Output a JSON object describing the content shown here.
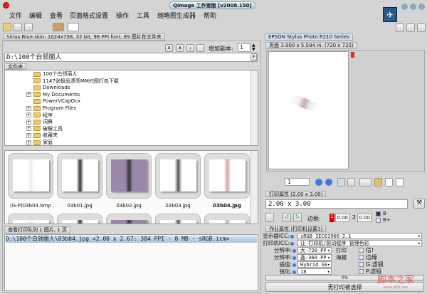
{
  "window": {
    "title": "Qimage 工作室版 [v2008.150]"
  },
  "menu": [
    "文件",
    "编辑",
    "查看",
    "页面格式设置",
    "操作",
    "工具",
    "缩略图生成器",
    "帮助"
  ],
  "status_tab": "Sirius Blue skin: 1024x738, 32 bit, 96 PPI font, 89 图片在文件夹",
  "copies": {
    "label": "增加副本:",
    "value": "1"
  },
  "path": "D:\\100个白领丽人",
  "folder_header": "文件夹",
  "tree": [
    {
      "label": "100个白领丽人",
      "expand": false
    },
    {
      "label": "1147张极品漂亮MM扫图打包下载",
      "expand": false
    },
    {
      "label": "Downloads",
      "expand": false
    },
    {
      "label": "My Documents",
      "expand": true
    },
    {
      "label": "PowerVCapOcx",
      "expand": false
    },
    {
      "label": "Program Files",
      "expand": true
    },
    {
      "label": "程序",
      "expand": true
    },
    {
      "label": "词典",
      "expand": true
    },
    {
      "label": "破解工具",
      "expand": true
    },
    {
      "label": "收藏夹",
      "expand": true
    },
    {
      "label": "家庭",
      "expand": true
    }
  ],
  "thumbnails": [
    "(G-P)03b04.bmp",
    "03b01.jpg",
    "03b02.jpg",
    "03b03.jpg",
    "03b04.jpg"
  ],
  "queue": {
    "header": "查看打印队列 1 图片, 1 页",
    "items": [
      "D:\\100个白领丽人\\03b04.jpg <2.00 x 2.67:  384 PPI -   8 MB - sRGB.icm>"
    ]
  },
  "printer": {
    "tab": "EPSON Stylus Photo R210 Series",
    "page_info": "页面 3.900 x 5.594 in.  (720 x 720)",
    "page_number": "1"
  },
  "print_props": {
    "header": "打印属性 (2.00 x 3.00)",
    "size": "2.00 x 3.00",
    "border_label": "边框:",
    "margin1_label": "1",
    "margin1": "0.00",
    "margin2_label": "2",
    "margin2": "0.00",
    "opt_b": "B",
    "opt_bplus": "B+"
  },
  "job": {
    "header": "作业属性 (打印机设置1)",
    "rows": [
      {
        "label": "显示器ICC:",
        "value": "sRGB IEC61966-2.1"
      },
      {
        "label": "打印机ICC:",
        "value": "让 打印机/驱动程序 管理色彩"
      },
      {
        "label": "分辨率:",
        "value": "大-720 PP",
        "suffix": "打印"
      },
      {
        "label": "分辨率:",
        "value": "晶-360 PP",
        "suffix": "海报"
      },
      {
        "label": "插值:",
        "value": "Hybrid SE"
      },
      {
        "label": "锐化:",
        "value": "18"
      }
    ],
    "checks": [
      "信!",
      "边缘",
      "G.滤镜",
      "P.滤镜"
    ]
  },
  "progress": {
    "percent": 0,
    "label": "0%"
  },
  "print_button": "无打印被选择",
  "watermark": {
    "text": "脚本之家",
    "url": "www.jb51.net"
  }
}
